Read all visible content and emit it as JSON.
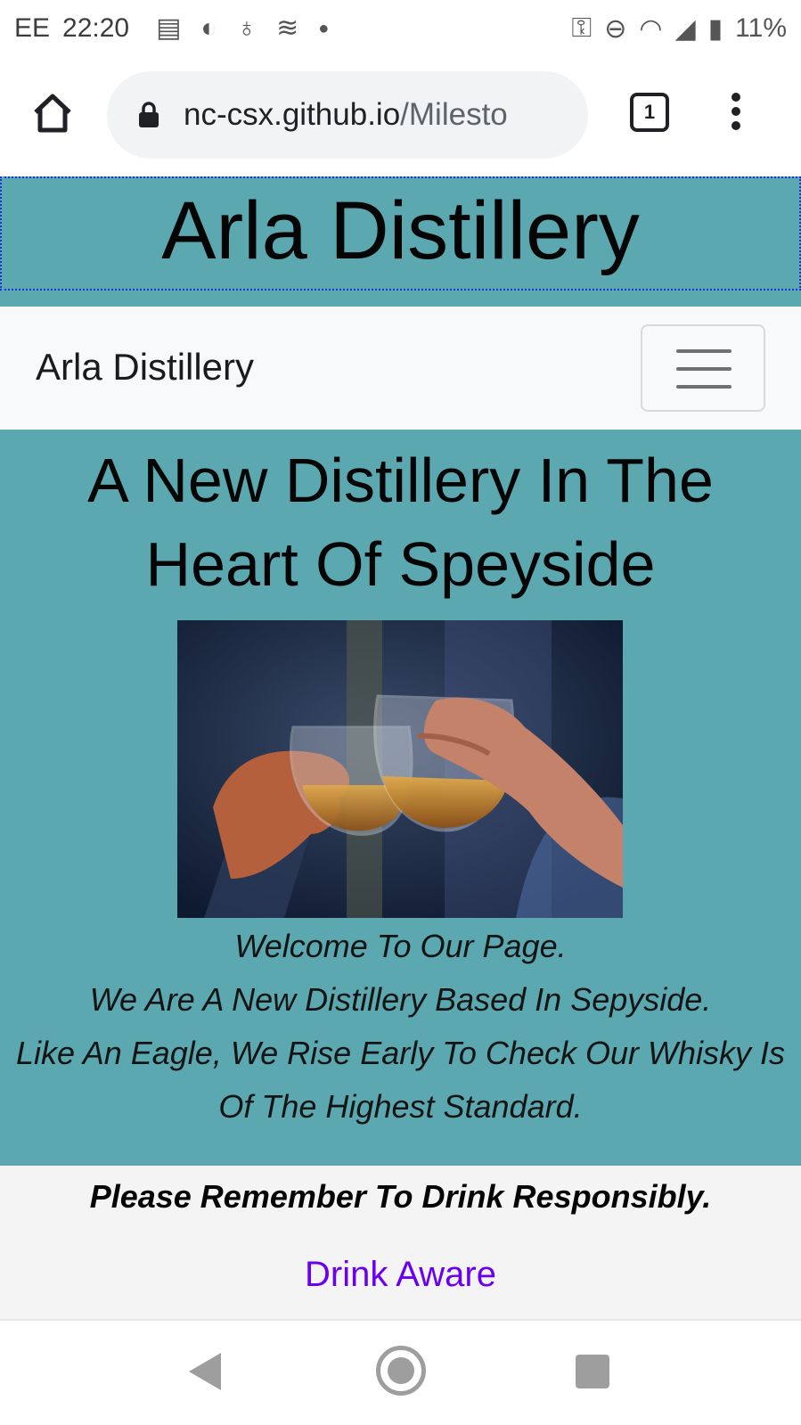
{
  "status_bar": {
    "carrier": "EE",
    "time": "22:20",
    "battery": "11%",
    "icons": [
      "news-icon",
      "browser-app-icon",
      "bulb-icon",
      "layers-icon",
      "dot-icon",
      "key-icon",
      "dnd-icon",
      "wifi-icon",
      "signal-icon",
      "battery-charging-icon"
    ]
  },
  "browser": {
    "url_host": "nc-csx.github.io",
    "url_path": "/Milesto",
    "tab_count": "1"
  },
  "header": {
    "title": "Arla Distillery"
  },
  "navbar": {
    "brand": "Arla Distillery"
  },
  "main": {
    "heading": "A New Distillery In The Heart Of Speyside",
    "image_alt": "two hands clinking whisky glasses",
    "welcome_lines": [
      "Welcome To Our Page.",
      "We Are A New Distillery Based In Sepyside.",
      "Like An Eagle, We Rise Early To Check Our Whisky Is Of The Highest Standard."
    ]
  },
  "footer": {
    "notice": "Please Remember To Drink Responsibly.",
    "link": "Drink Aware"
  },
  "colors": {
    "teal": "#5ba8b0",
    "link": "#6b00f0",
    "navbar_bg": "#f8f9fa"
  }
}
